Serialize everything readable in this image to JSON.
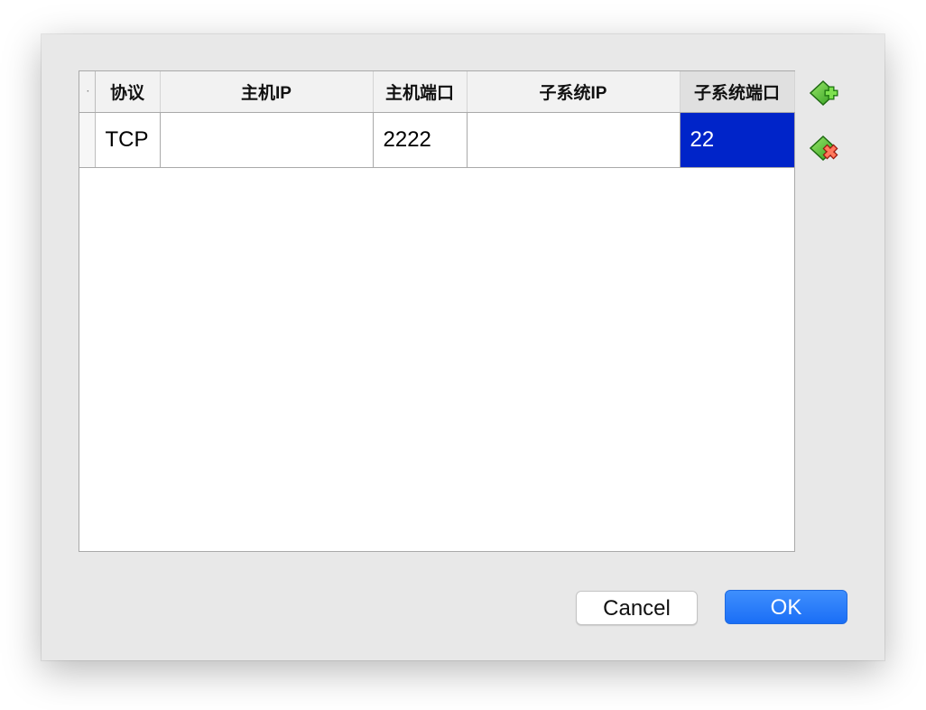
{
  "table": {
    "row_header_marker": "·",
    "columns": [
      {
        "label": "协议"
      },
      {
        "label": "主机IP"
      },
      {
        "label": "主机端口"
      },
      {
        "label": "子系统IP"
      },
      {
        "label": "子系统端口"
      }
    ],
    "rows": [
      {
        "protocol": "TCP",
        "host_ip": "",
        "host_port": "2222",
        "guest_ip": "",
        "guest_port": "22"
      }
    ],
    "selected_cell": "guest_port"
  },
  "actions": {
    "add_icon": "add-rule-icon",
    "remove_icon": "remove-rule-icon"
  },
  "buttons": {
    "cancel_label": "Cancel",
    "ok_label": "OK"
  },
  "colors": {
    "selection": "#0024c9",
    "ok_button": "#1a6ef6"
  }
}
